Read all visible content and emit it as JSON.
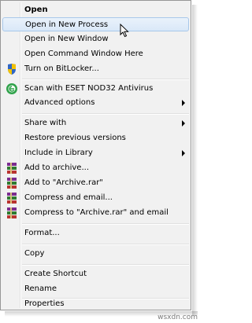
{
  "menu": {
    "items": [
      {
        "label": "Open",
        "bold": true
      },
      {
        "label": "Open in New Process",
        "highlighted": true
      },
      {
        "label": "Open in New Window"
      },
      {
        "label": "Open Command Window Here"
      },
      {
        "label": "Turn on BitLocker...",
        "icon": "shield-icon"
      },
      {
        "label": "Scan with ESET NOD32 Antivirus",
        "icon": "eset-icon"
      },
      {
        "label": "Advanced options",
        "submenu": true
      },
      {
        "label": "Share with",
        "submenu": true
      },
      {
        "label": "Restore previous versions"
      },
      {
        "label": "Include in Library",
        "submenu": true
      },
      {
        "label": "Add to archive...",
        "icon": "winrar-icon"
      },
      {
        "label": "Add to \"Archive.rar\"",
        "icon": "winrar-icon"
      },
      {
        "label": "Compress and email...",
        "icon": "winrar-icon"
      },
      {
        "label": "Compress to \"Archive.rar\" and email",
        "icon": "winrar-icon"
      },
      {
        "label": "Format..."
      },
      {
        "label": "Copy"
      },
      {
        "label": "Create Shortcut"
      },
      {
        "label": "Rename"
      },
      {
        "label": "Properties"
      }
    ]
  },
  "colors": {
    "menu_bg": "#f1f1f1",
    "highlight_border": "#a8c8ea",
    "highlight_bg": "#dde9f7"
  },
  "watermark": "wsxdn.com"
}
